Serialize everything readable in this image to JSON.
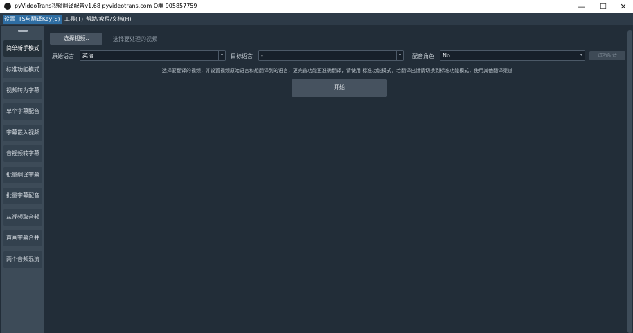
{
  "window": {
    "title": "pyVideoTrans视频翻译配音v1.68 pyvideotrans.com  Q群 905857759",
    "controls": {
      "minimize": "—",
      "maximize": "☐",
      "close": "✕"
    }
  },
  "menu": {
    "items": [
      {
        "label": "设置TTS与翻译Key(S)"
      },
      {
        "label": "工具(T)"
      },
      {
        "label": "帮助/教程/文档(H)"
      }
    ]
  },
  "sidebar": {
    "items": [
      {
        "label": "简单新手模式"
      },
      {
        "label": "标准功能模式"
      },
      {
        "label": "视频转为字幕"
      },
      {
        "label": "单个字幕配音"
      },
      {
        "label": "字幕嵌入视频"
      },
      {
        "label": "音视频转字幕"
      },
      {
        "label": "批量翻译字幕"
      },
      {
        "label": "批量字幕配音"
      },
      {
        "label": "从视频取音频"
      },
      {
        "label": "声画字幕合并"
      },
      {
        "label": "两个音频混流"
      }
    ]
  },
  "main": {
    "select_video_button": "选择视频..",
    "select_video_placeholder": "选择要处理的视频",
    "source_language": {
      "label": "原始语言",
      "value": "英语"
    },
    "target_language": {
      "label": "目标语言",
      "value": "-"
    },
    "voice_role": {
      "label": "配音角色",
      "value": "No"
    },
    "preview_voice_button": "试听配音",
    "hint": "选择要翻译的视频，并设置视频原始语言和想翻译到的语言，更完善功能更准确翻译，请使用 标准功能模式，若翻译出错请切换到标准功能模式，使用其他翻译渠道",
    "start_button": "开始"
  },
  "colors": {
    "background": "#222d38",
    "sidebar": "#3d4b58",
    "menubar": "#2d3a47",
    "menu_active": "#2f6ea3",
    "button": "#46525f"
  }
}
